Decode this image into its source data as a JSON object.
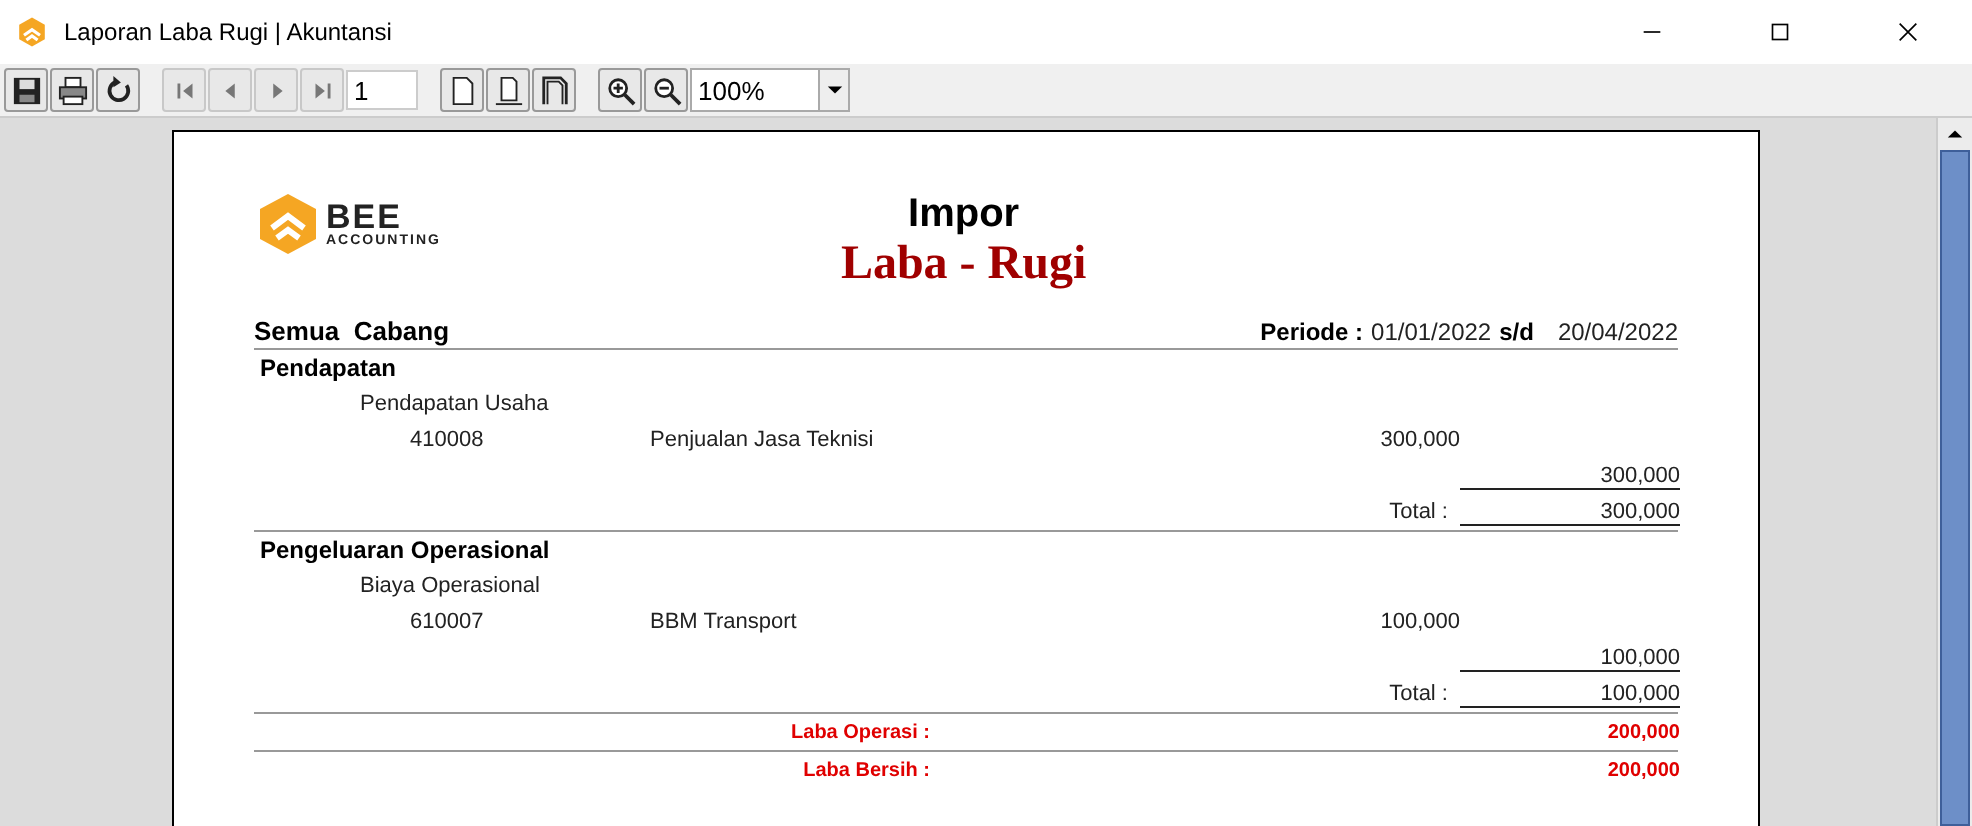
{
  "window": {
    "title": "Laporan Laba Rugi | Akuntansi"
  },
  "toolbar": {
    "page": "1",
    "zoom": "100%"
  },
  "report": {
    "logo": {
      "name": "BEE",
      "tagline": "ACCOUNTING"
    },
    "title": "Impor",
    "subtitle": "Laba - Rugi",
    "branch": "Semua  Cabang",
    "period_label": "Periode :",
    "period_from": "01/01/2022",
    "period_sep": "s/d",
    "period_to": "20/04/2022",
    "sections": [
      {
        "name": "Pendapatan",
        "groups": [
          {
            "name": "Pendapatan Usaha",
            "accounts": [
              {
                "code": "410008",
                "name": "Penjualan Jasa Teknisi",
                "amount": "300,000"
              }
            ],
            "subtotal": "300,000"
          }
        ],
        "total_label": "Total :",
        "total": "300,000"
      },
      {
        "name": "Pengeluaran Operasional",
        "groups": [
          {
            "name": "Biaya Operasional",
            "accounts": [
              {
                "code": "610007",
                "name": "BBM Transport",
                "amount": "100,000"
              }
            ],
            "subtotal": "100,000"
          }
        ],
        "total_label": "Total :",
        "total": "100,000"
      }
    ],
    "summary": [
      {
        "label": "Laba Operasi :",
        "value": "200,000"
      },
      {
        "label": "Laba Bersih :",
        "value": "200,000"
      }
    ]
  }
}
